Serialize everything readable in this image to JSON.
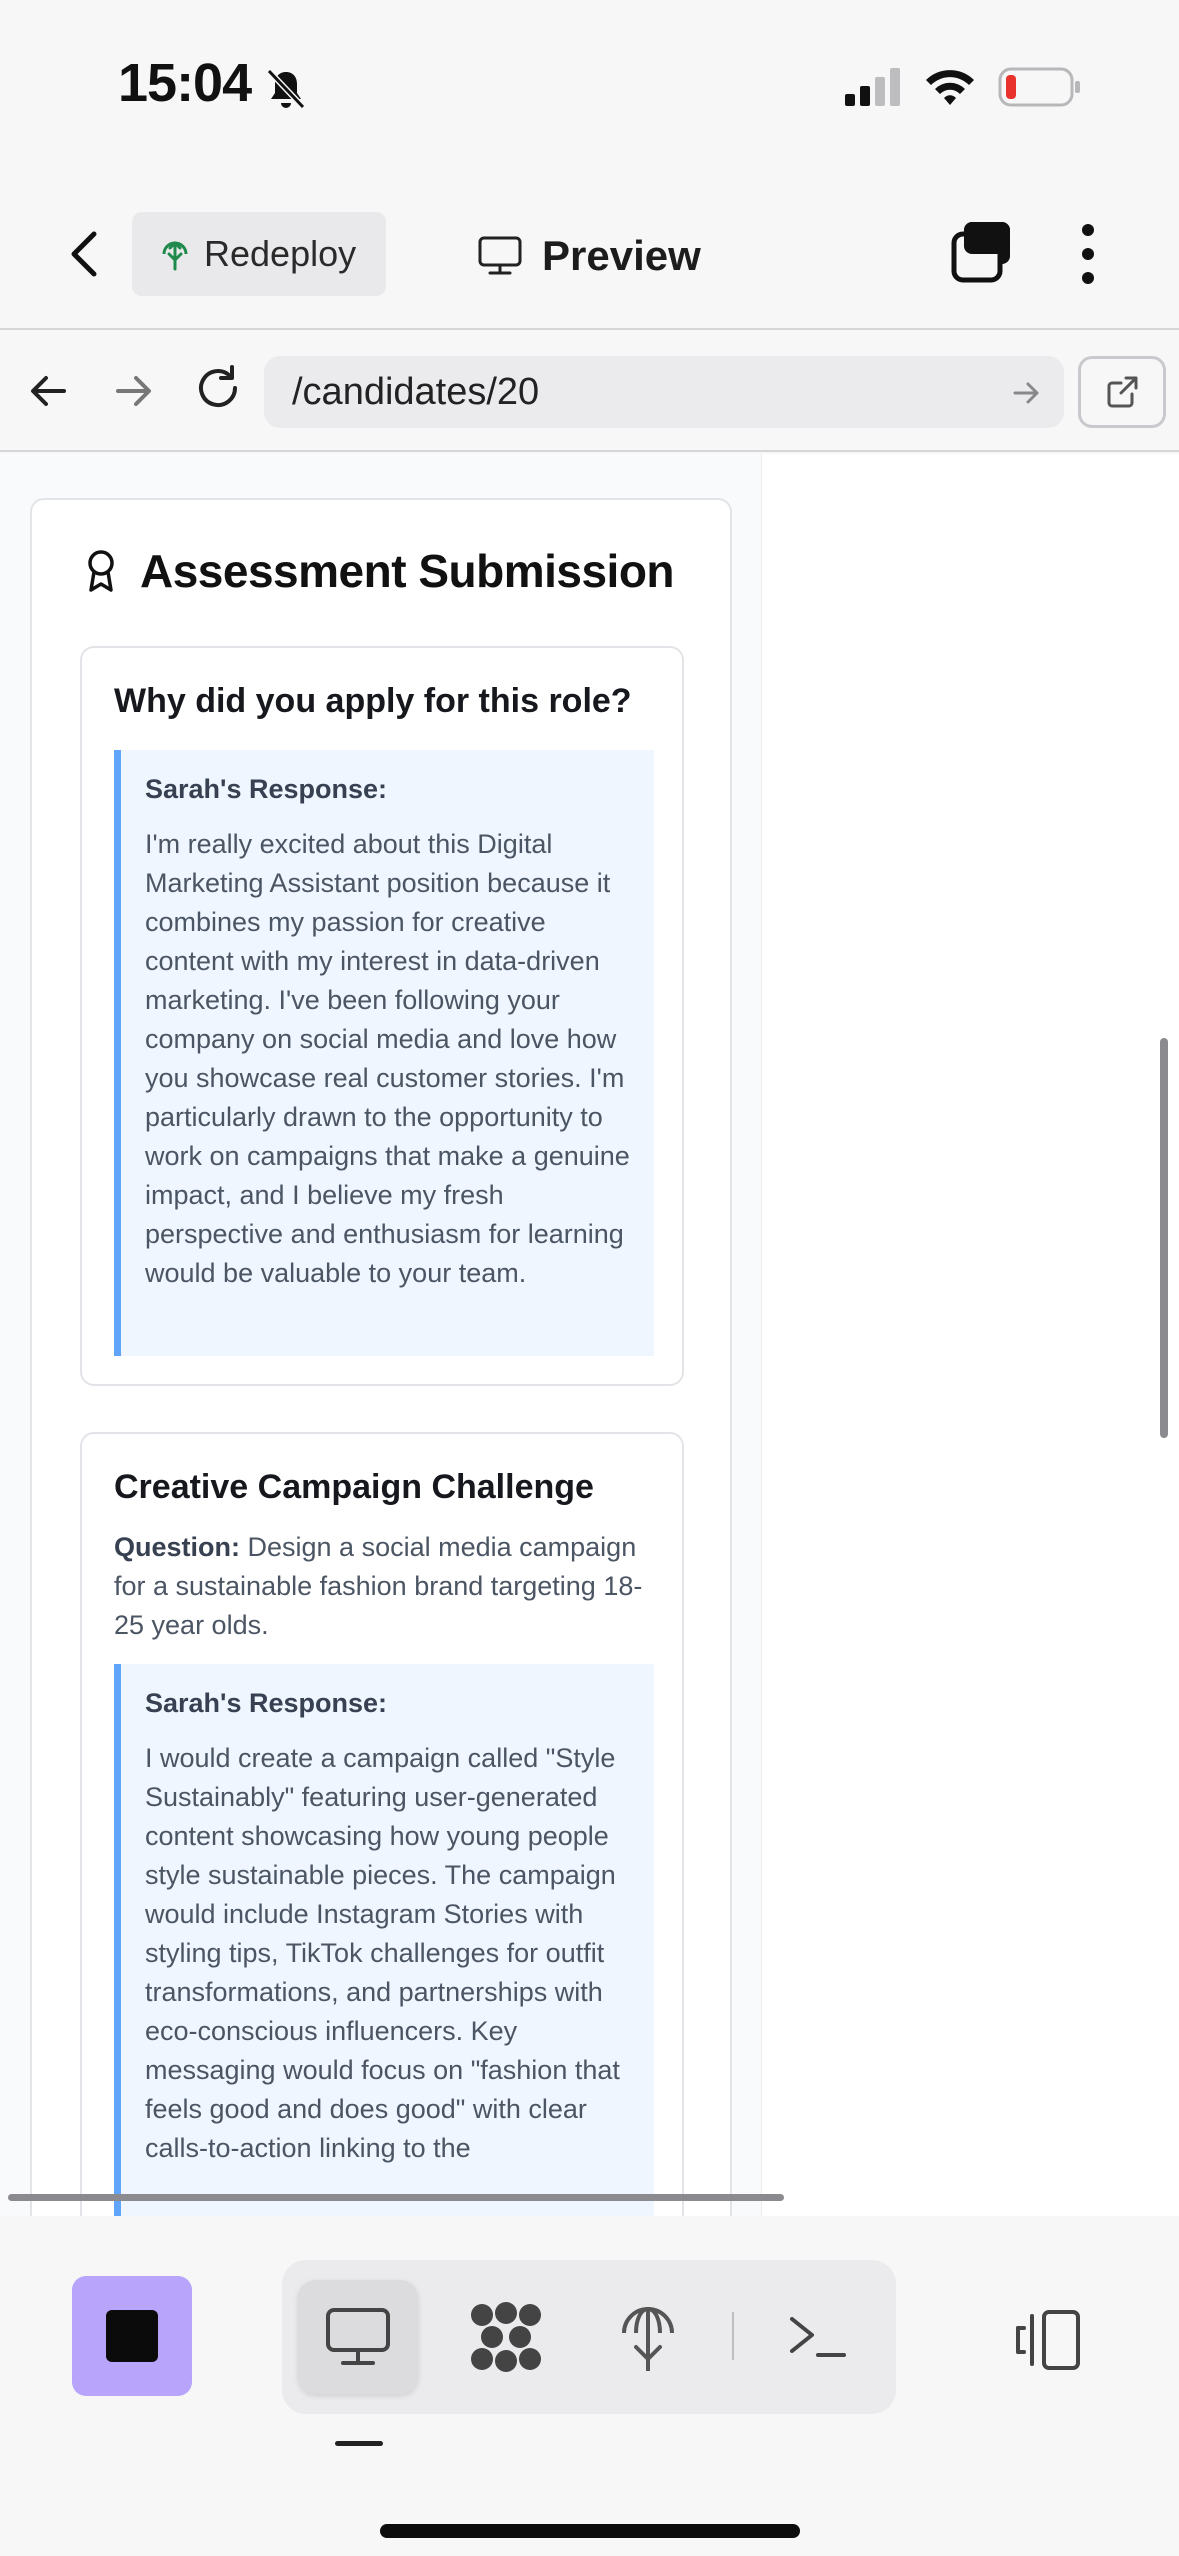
{
  "status_bar": {
    "time": "15:04",
    "icons": [
      "bell-slash-icon",
      "cellular-signal-icon",
      "wifi-icon",
      "battery-low-icon"
    ]
  },
  "header": {
    "redeploy_label": "Redeploy",
    "preview_label": "Preview",
    "icons": [
      "back-chevron-icon",
      "redeploy-icon",
      "desktop-icon",
      "layers-icon",
      "more-vertical-icon"
    ]
  },
  "browser": {
    "url": "/candidates/20",
    "icons": [
      "arrow-left-icon",
      "arrow-right-icon",
      "reload-icon",
      "url-go-icon",
      "open-external-icon"
    ]
  },
  "assessment": {
    "title": "Assessment Submission",
    "questions": [
      {
        "title": "Why did you apply for this role?",
        "response_label": "Sarah's Response:",
        "response": "I'm really excited about this Digital Marketing Assistant position because it combines my passion for creative content with my interest in data-driven marketing. I've been following your company on social media and love how you showcase real customer stories. I'm particularly drawn to the opportunity to work on campaigns that make a genuine impact, and I believe my fresh perspective and enthusiasm for learning would be valuable to your team."
      },
      {
        "title": "Creative Campaign Challenge",
        "question_label": "Question:",
        "question": " Design a social media campaign for a sustainable fashion brand targeting 18-25 year olds.",
        "response_label": "Sarah's Response:",
        "response": "I would create a campaign called \"Style Sustainably\" featuring user-generated content showcasing how young people style sustainable pieces. The campaign would include Instagram Stories with styling tips, TikTok challenges for outfit transformations, and partnerships with eco-conscious influencers. Key messaging would focus on \"fashion that feels good and does good\" with clear calls-to-action linking to the"
      }
    ]
  },
  "toolbar": {
    "tools": [
      "stop-icon",
      "desktop-icon",
      "graph-icon",
      "deploy-icon",
      "console-icon",
      "panel-toggle-icon"
    ],
    "active_tool": "desktop",
    "accent_color": "#b8a4fb"
  },
  "colors": {
    "response_bg": "#eff6ff",
    "response_border": "#60a5fa",
    "redeploy_icon": "#1f8a4c",
    "battery_low": "#e8322b"
  }
}
